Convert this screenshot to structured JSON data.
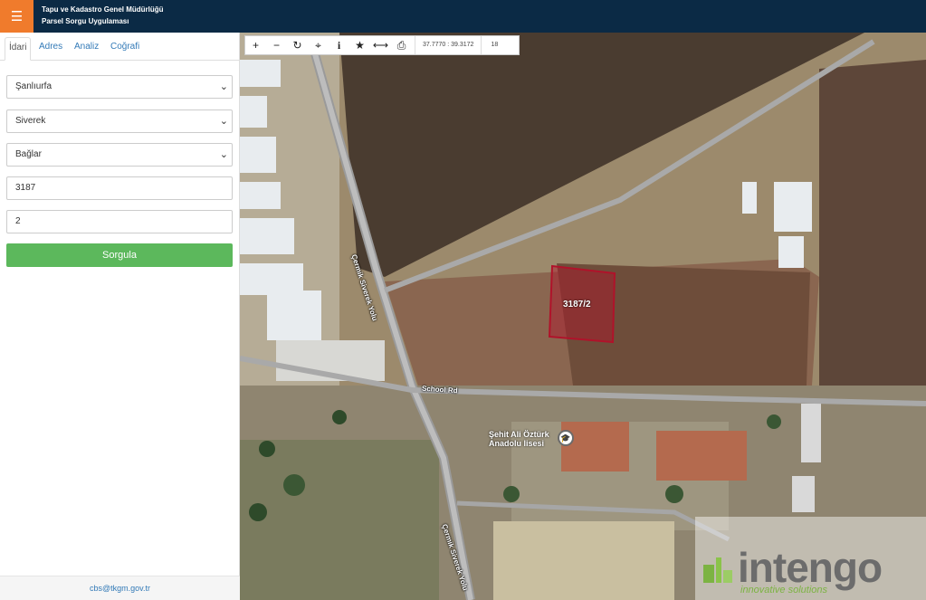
{
  "header": {
    "menu_icon": "☰",
    "title_line1": "Tapu ve Kadastro Genel Müdürlüğü",
    "title_line2": "Parsel Sorgu Uygulaması"
  },
  "tabs": [
    {
      "label": "İdari"
    },
    {
      "label": "Adres"
    },
    {
      "label": "Analiz"
    },
    {
      "label": "Coğrafi"
    }
  ],
  "form": {
    "il": "Şanlıurfa",
    "ilce": "Siverek",
    "mahalle": "Bağlar",
    "ada": "3187",
    "parsel": "2",
    "submit_label": "Sorgula"
  },
  "footer": {
    "email": "cbs@tkgm.gov.tr"
  },
  "toolbar": {
    "zoom_in": "+",
    "zoom_out": "−",
    "refresh": "↻",
    "locate": "⌖",
    "info": "i",
    "favorite": "★",
    "measure": "⟷",
    "print": "⎙",
    "coordinates": "37.7770 : 39.3172",
    "zoom_level": "18"
  },
  "map": {
    "parcel_label": "3187/2",
    "road_top": "Çermik Siverek Yolu",
    "road_bottom": "Çermik Siverek Yolu",
    "road_school": "School Rd",
    "poi_line1": "Şehit Ali Öztürk",
    "poi_line2": "Anadolu lisesi",
    "poi_icon": "🎓",
    "colors": {
      "parcel": "#b0122a",
      "topbar": "#0b2a45",
      "menu": "#f07b2c",
      "submit": "#5cb85c"
    }
  },
  "watermark": {
    "brand": "intengo",
    "tagline": "innovative solutions"
  }
}
